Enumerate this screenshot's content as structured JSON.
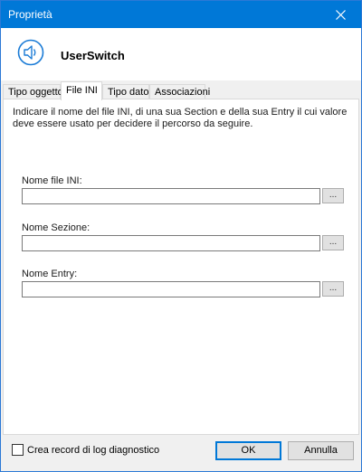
{
  "window": {
    "title": "Proprietà"
  },
  "header": {
    "app_name": "UserSwitch",
    "icon": "speaker-icon"
  },
  "tabs": [
    {
      "label": "Tipo oggetto",
      "active": false
    },
    {
      "label": "File INI",
      "active": true
    },
    {
      "label": "Tipo dato",
      "active": false
    },
    {
      "label": "Associazioni",
      "active": false
    }
  ],
  "panel": {
    "description": "Indicare il nome del file INI, di una sua Section e della sua Entry il cui valore deve essere usato per decidere il percorso da seguire.",
    "fields": [
      {
        "label": "Nome file INI:",
        "value": "",
        "browse_label": "..."
      },
      {
        "label": "Nome Sezione:",
        "value": "",
        "browse_label": "..."
      },
      {
        "label": "Nome Entry:",
        "value": "",
        "browse_label": "..."
      }
    ]
  },
  "footer": {
    "log_checkbox_label": "Crea record di log diagnostico",
    "log_checkbox_checked": false,
    "ok_label": "OK",
    "cancel_label": "Annulla"
  },
  "colors": {
    "titlebar": "#0078d7",
    "accent": "#0078d7",
    "icon": "#1a7bd6"
  }
}
